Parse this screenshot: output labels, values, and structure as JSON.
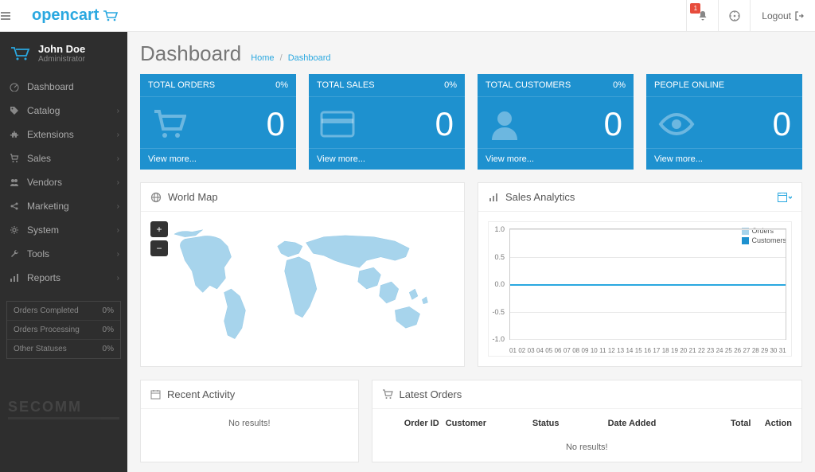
{
  "brand": "opencart",
  "top": {
    "notif_count": "1",
    "logout_label": "Logout"
  },
  "user": {
    "name": "John Doe",
    "role": "Administrator"
  },
  "sidebar": [
    {
      "icon": "dashboard",
      "label": "Dashboard",
      "chev": false
    },
    {
      "icon": "tag",
      "label": "Catalog",
      "chev": true
    },
    {
      "icon": "puzzle",
      "label": "Extensions",
      "chev": true
    },
    {
      "icon": "cart",
      "label": "Sales",
      "chev": true
    },
    {
      "icon": "users",
      "label": "Vendors",
      "chev": true
    },
    {
      "icon": "share",
      "label": "Marketing",
      "chev": true
    },
    {
      "icon": "gear",
      "label": "System",
      "chev": true
    },
    {
      "icon": "wrench",
      "label": "Tools",
      "chev": true
    },
    {
      "icon": "chart",
      "label": "Reports",
      "chev": true
    }
  ],
  "sidebar_stats": [
    {
      "label": "Orders Completed",
      "value": "0%"
    },
    {
      "label": "Orders Processing",
      "value": "0%"
    },
    {
      "label": "Other Statuses",
      "value": "0%"
    }
  ],
  "watermark": "SECOMM",
  "page_title": "Dashboard",
  "breadcrumb": {
    "home": "Home",
    "current": "Dashboard"
  },
  "tiles": [
    {
      "title": "TOTAL ORDERS",
      "pct": "0%",
      "value": "0",
      "link": "View more...",
      "icon": "cart"
    },
    {
      "title": "TOTAL SALES",
      "pct": "0%",
      "value": "0",
      "link": "View more...",
      "icon": "card"
    },
    {
      "title": "TOTAL CUSTOMERS",
      "pct": "0%",
      "value": "0",
      "link": "View more...",
      "icon": "user"
    },
    {
      "title": "PEOPLE ONLINE",
      "pct": "",
      "value": "0",
      "link": "View more...",
      "icon": "eye"
    }
  ],
  "map": {
    "title": "World Map"
  },
  "analytics": {
    "title": "Sales Analytics"
  },
  "recent": {
    "title": "Recent Activity",
    "empty": "No results!"
  },
  "latest": {
    "title": "Latest Orders",
    "empty": "No results!",
    "cols": {
      "id": "Order ID",
      "customer": "Customer",
      "status": "Status",
      "date": "Date Added",
      "total": "Total",
      "action": "Action"
    }
  },
  "chart_data": {
    "type": "line",
    "x": [
      "01",
      "02",
      "03",
      "04",
      "05",
      "06",
      "07",
      "08",
      "09",
      "10",
      "11",
      "12",
      "13",
      "14",
      "15",
      "16",
      "17",
      "18",
      "19",
      "20",
      "21",
      "22",
      "23",
      "24",
      "25",
      "26",
      "27",
      "28",
      "29",
      "30",
      "31"
    ],
    "series": [
      {
        "name": "Orders",
        "color": "#a7d4ec",
        "values": [
          0,
          0,
          0,
          0,
          0,
          0,
          0,
          0,
          0,
          0,
          0,
          0,
          0,
          0,
          0,
          0,
          0,
          0,
          0,
          0,
          0,
          0,
          0,
          0,
          0,
          0,
          0,
          0,
          0,
          0,
          0
        ]
      },
      {
        "name": "Customers",
        "color": "#1e91cf",
        "values": [
          0,
          0,
          0,
          0,
          0,
          0,
          0,
          0,
          0,
          0,
          0,
          0,
          0,
          0,
          0,
          0,
          0,
          0,
          0,
          0,
          0,
          0,
          0,
          0,
          0,
          0,
          0,
          0,
          0,
          0,
          0
        ]
      }
    ],
    "ylim": [
      -1.0,
      1.0
    ],
    "yticks": [
      "1.0",
      "0.5",
      "0.0",
      "-0.5",
      "-1.0"
    ]
  }
}
